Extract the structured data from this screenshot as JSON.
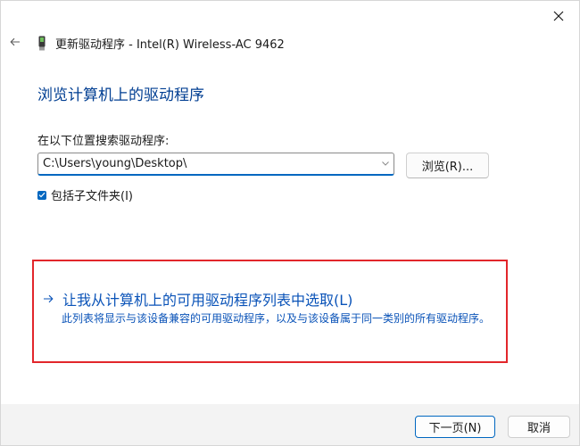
{
  "window": {
    "title": "更新驱动程序 - Intel(R) Wireless-AC 9462",
    "device_icon": "network-adapter-icon",
    "close_icon": "close-icon",
    "back_icon": "back-arrow-icon"
  },
  "page": {
    "heading": "浏览计算机上的驱动程序",
    "search_label": "在以下位置搜索驱动程序:",
    "path_value": "C:\\Users\\young\\Desktop\\",
    "browse_label": "浏览(R)...",
    "include_subfolders_label": "包括子文件夹(I)",
    "include_subfolders_checked": true
  },
  "pick_option": {
    "title": "让我从计算机上的可用驱动程序列表中选取(L)",
    "description": "此列表将显示与该设备兼容的可用驱动程序，以及与该设备属于同一类别的所有驱动程序。",
    "icon": "arrow-right-icon"
  },
  "footer": {
    "next_label": "下一页(N)",
    "cancel_label": "取消"
  },
  "colors": {
    "accent": "#0067c0",
    "link": "#0a53b8",
    "heading": "#003e92",
    "highlight_border": "#e2262b"
  }
}
